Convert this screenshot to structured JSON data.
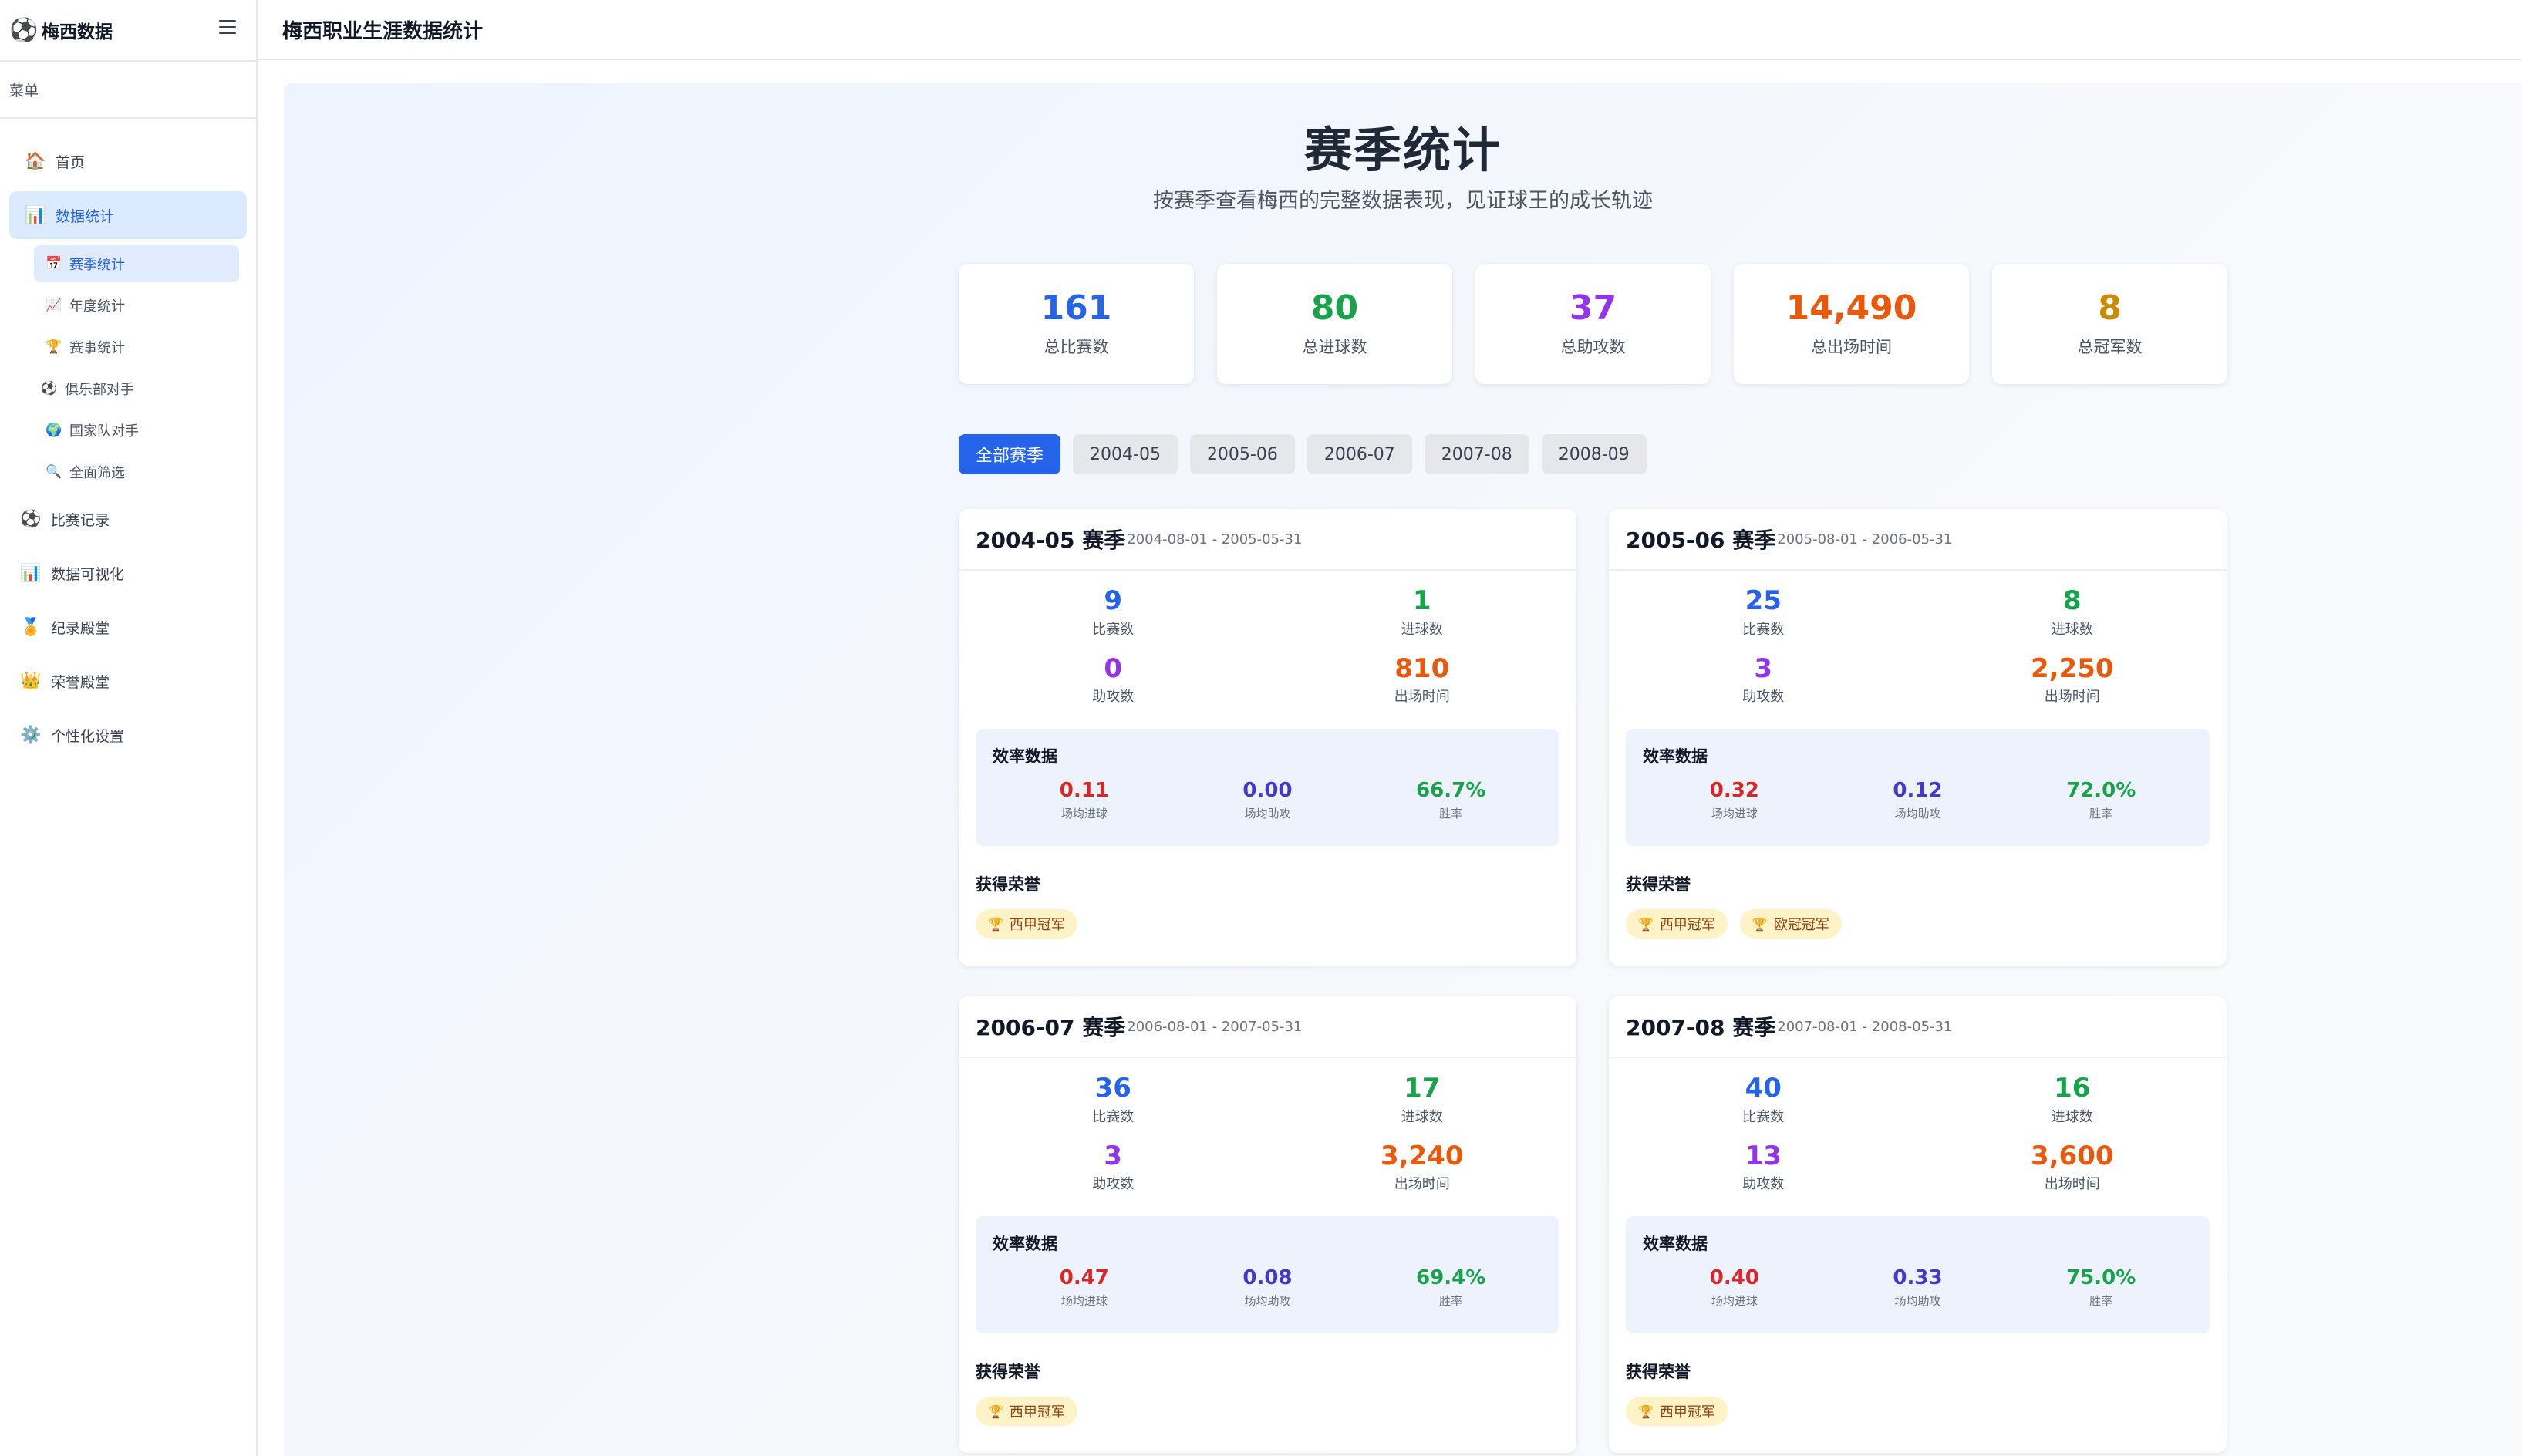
{
  "brand": {
    "icon": "soccer-ball-icon",
    "name": "梅西数据"
  },
  "header": {
    "title": "梅西职业生涯数据统计"
  },
  "sidebar": {
    "menu_title": "菜单",
    "items": [
      {
        "icon": "house-icon",
        "glyph": "🏠",
        "label": "首页"
      },
      {
        "icon": "bar-chart-icon",
        "glyph": "📊",
        "label": "数据统计"
      },
      {
        "icon": "soccer-ball-icon",
        "glyph": "⚽",
        "label": "比赛记录"
      },
      {
        "icon": "bar-chart-icon",
        "glyph": "📊",
        "label": "数据可视化"
      },
      {
        "icon": "medal-icon",
        "glyph": "🏅",
        "label": "纪录殿堂"
      },
      {
        "icon": "crown-icon",
        "glyph": "👑",
        "label": "荣誉殿堂"
      },
      {
        "icon": "gear-icon",
        "glyph": "⚙️",
        "label": "个性化设置"
      }
    ],
    "sub_items": [
      {
        "icon": "calendar-icon",
        "glyph": "📅",
        "label": "赛季统计"
      },
      {
        "icon": "line-chart-icon",
        "glyph": "📈",
        "label": "年度统计"
      },
      {
        "icon": "trophy-icon",
        "glyph": "🏆",
        "label": "赛事统计"
      },
      {
        "icon": "soccer-ball-icon",
        "glyph": "⚽",
        "label": "俱乐部对手"
      },
      {
        "icon": "globe-icon",
        "glyph": "🌍",
        "label": "国家队对手"
      },
      {
        "icon": "search-icon",
        "glyph": "🔍",
        "label": "全面筛选"
      }
    ]
  },
  "page": {
    "title": "赛季统计",
    "subtitle": "按赛季查看梅西的完整数据表现，见证球王的成长轨迹"
  },
  "summary": [
    {
      "value": "161",
      "label": "总比赛数",
      "color": "#2563eb"
    },
    {
      "value": "80",
      "label": "总进球数",
      "color": "#16a34a"
    },
    {
      "value": "37",
      "label": "总助攻数",
      "color": "#9333ea"
    },
    {
      "value": "14,490",
      "label": "总出场时间",
      "color": "#ea580c"
    },
    {
      "value": "8",
      "label": "总冠军数",
      "color": "#ca8a04"
    }
  ],
  "tabs": [
    "全部赛季",
    "2004-05",
    "2005-06",
    "2006-07",
    "2007-08",
    "2008-09"
  ],
  "labels": {
    "matches": "比赛数",
    "goals": "进球数",
    "assists": "助攻数",
    "minutes": "出场时间",
    "efficiency": "效率数据",
    "goals_per_game": "场均进球",
    "assists_per_game": "场均助攻",
    "win_rate": "胜率",
    "honors": "获得荣誉"
  },
  "seasons": [
    {
      "title": "2004-05 赛季",
      "dates": "2004-08-01 - 2005-05-31",
      "matches": "9",
      "goals": "1",
      "assists": "0",
      "minutes": "810",
      "goals_per_game": "0.11",
      "assists_per_game": "0.00",
      "win_rate": "66.7%",
      "honors": [
        {
          "icon": "trophy-icon",
          "label": "西甲冠军"
        }
      ]
    },
    {
      "title": "2005-06 赛季",
      "dates": "2005-08-01 - 2006-05-31",
      "matches": "25",
      "goals": "8",
      "assists": "3",
      "minutes": "2,250",
      "goals_per_game": "0.32",
      "assists_per_game": "0.12",
      "win_rate": "72.0%",
      "honors": [
        {
          "icon": "trophy-icon",
          "label": "西甲冠军"
        },
        {
          "icon": "trophy-icon",
          "label": "欧冠冠军"
        }
      ]
    },
    {
      "title": "2006-07 赛季",
      "dates": "2006-08-01 - 2007-05-31",
      "matches": "36",
      "goals": "17",
      "assists": "3",
      "minutes": "3,240",
      "goals_per_game": "0.47",
      "assists_per_game": "0.08",
      "win_rate": "69.4%",
      "honors": [
        {
          "icon": "trophy-icon",
          "label": "西甲冠军"
        }
      ]
    },
    {
      "title": "2007-08 赛季",
      "dates": "2007-08-01 - 2008-05-31",
      "matches": "40",
      "goals": "16",
      "assists": "13",
      "minutes": "3,600",
      "goals_per_game": "0.40",
      "assists_per_game": "0.33",
      "win_rate": "75.0%",
      "honors": [
        {
          "icon": "trophy-icon",
          "label": "西甲冠军"
        }
      ]
    }
  ]
}
